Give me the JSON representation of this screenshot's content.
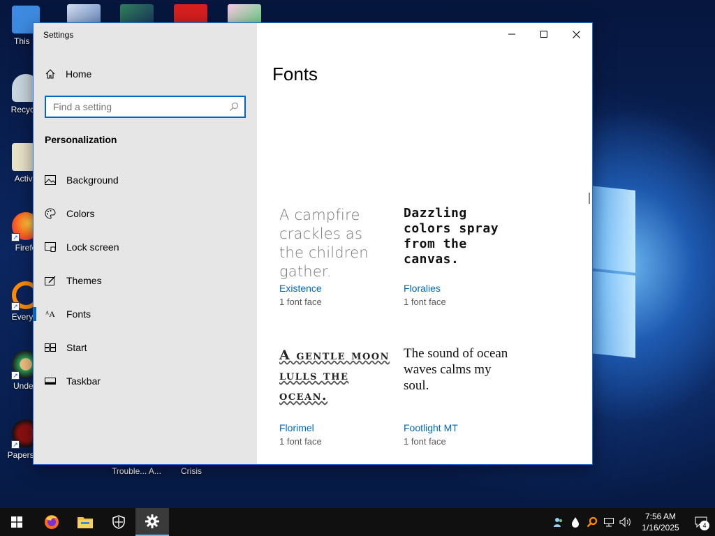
{
  "desktop": {
    "icons": [
      {
        "label": "This P",
        "color": "#3d8be0"
      },
      {
        "label": "Recycle",
        "color": "#c9d6de"
      },
      {
        "label": "Activa",
        "color": "#e8e2c8"
      },
      {
        "label": "Firefo",
        "color": "#ff7a1f"
      },
      {
        "label": "Everyth",
        "color": "#ff8c00"
      },
      {
        "label": "Undert",
        "color": "#2aa35a"
      },
      {
        "label": "Papers, P",
        "color": "#8a1010"
      }
    ],
    "under_labels": [
      "Trouble... A...",
      "Crisis"
    ]
  },
  "window": {
    "title": "Settings",
    "controls": {
      "minimize": "minimize-icon",
      "maximize": "maximize-icon",
      "close": "close-icon"
    }
  },
  "sidebar": {
    "home_label": "Home",
    "search_placeholder": "Find a setting",
    "section_title": "Personalization",
    "items": [
      {
        "label": "Background",
        "icon": "picture-icon"
      },
      {
        "label": "Colors",
        "icon": "palette-icon"
      },
      {
        "label": "Lock screen",
        "icon": "lock-screen-icon"
      },
      {
        "label": "Themes",
        "icon": "themes-icon"
      },
      {
        "label": "Fonts",
        "icon": "fonts-icon",
        "active": true
      },
      {
        "label": "Start",
        "icon": "start-icon"
      },
      {
        "label": "Taskbar",
        "icon": "taskbar-icon"
      }
    ]
  },
  "main": {
    "title": "Fonts",
    "fonts": [
      {
        "sample": "A campfire crackles as the children gather.",
        "name": "Existence",
        "faces": "1 font face"
      },
      {
        "sample": "Dazzling colors spray from the canvas.",
        "name": "Floralies",
        "faces": "1 font face"
      },
      {
        "sample": "A gentle moon lulls the ocean.",
        "name": "Florimel",
        "faces": "1 font face"
      },
      {
        "sample": "The sound of ocean waves calms my soul.",
        "name": "Footlight MT",
        "faces": "1 font face"
      }
    ]
  },
  "taskbar": {
    "apps": [
      "windows-start-icon",
      "firefox-icon",
      "file-explorer-icon",
      "security-icon",
      "settings-icon"
    ],
    "time": "7:56 AM",
    "date": "1/16/2025",
    "notification_count": "4",
    "accent": "#0067c0"
  }
}
